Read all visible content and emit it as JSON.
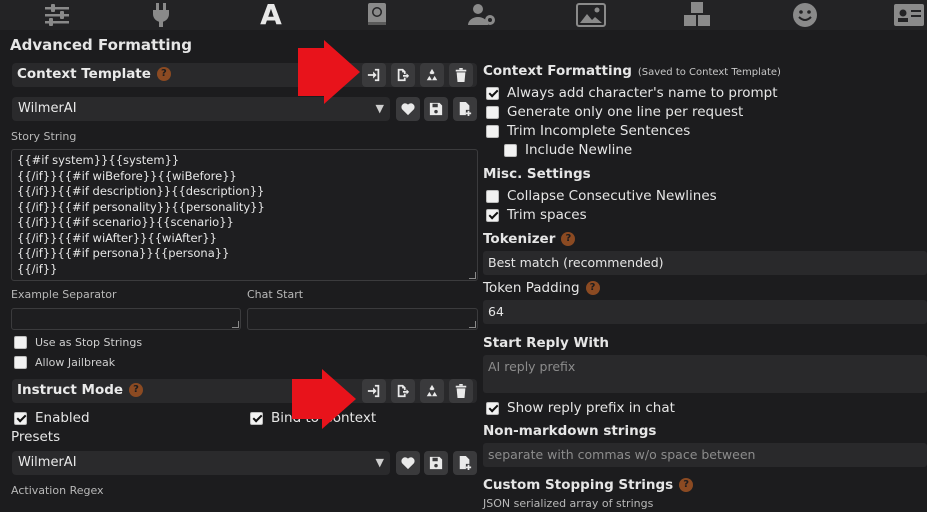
{
  "topbar": {
    "icons": [
      "sliders-icon",
      "plug-icon",
      "font-a-icon",
      "globe-book-icon",
      "user-gear-icon",
      "image-icon",
      "cubes-icon",
      "smile-icon",
      "id-card-icon"
    ],
    "active": "A"
  },
  "title": "Advanced Formatting",
  "context_template": {
    "header": "Context Template",
    "help": "?",
    "preset": "WilmerAI",
    "story_string_label": "Story String",
    "story_string": "{{#if system}}{{system}}\n{{/if}}{{#if wiBefore}}{{wiBefore}}\n{{/if}}{{#if description}}{{description}}\n{{/if}}{{#if personality}}{{personality}}\n{{/if}}{{#if scenario}}{{scenario}}\n{{/if}}{{#if wiAfter}}{{wiAfter}}\n{{/if}}{{#if persona}}{{persona}}\n{{/if}}",
    "example_separator_label": "Example Separator",
    "chat_start_label": "Chat Start",
    "use_as_stop_strings": "Use as Stop Strings",
    "allow_jailbreak": "Allow Jailbreak"
  },
  "instruct_mode": {
    "header": "Instruct Mode",
    "help": "?",
    "enabled": "Enabled",
    "bind_to_context": "Bind to Context",
    "presets_label": "Presets",
    "preset": "WilmerAI",
    "activation_regex_label": "Activation Regex"
  },
  "context_formatting": {
    "header": "Context Formatting",
    "note": "(Saved to Context Template)",
    "options": [
      {
        "label": "Always add character's name to prompt",
        "checked": true
      },
      {
        "label": "Generate only one line per request",
        "checked": false
      },
      {
        "label": "Trim Incomplete Sentences",
        "checked": false
      },
      {
        "label": "Include Newline",
        "checked": false
      }
    ],
    "misc_header": "Misc. Settings",
    "misc_options": [
      {
        "label": "Collapse Consecutive Newlines",
        "checked": false
      },
      {
        "label": "Trim spaces",
        "checked": true
      }
    ],
    "tokenizer_label": "Tokenizer",
    "tokenizer_value": "Best match (recommended)",
    "token_padding_label": "Token Padding",
    "token_padding_value": "64",
    "start_reply_label": "Start Reply With",
    "start_reply_placeholder": "AI reply prefix",
    "show_reply_prefix": "Show reply prefix in chat",
    "non_markdown_label": "Non-markdown strings",
    "non_markdown_placeholder": "separate with commas w/o space between",
    "custom_stopping_label": "Custom Stopping Strings",
    "custom_stopping_note": "JSON serialized array of strings"
  },
  "colors": {
    "accent_arrow": "#e8131b",
    "help_badge": "#8b4a22"
  }
}
